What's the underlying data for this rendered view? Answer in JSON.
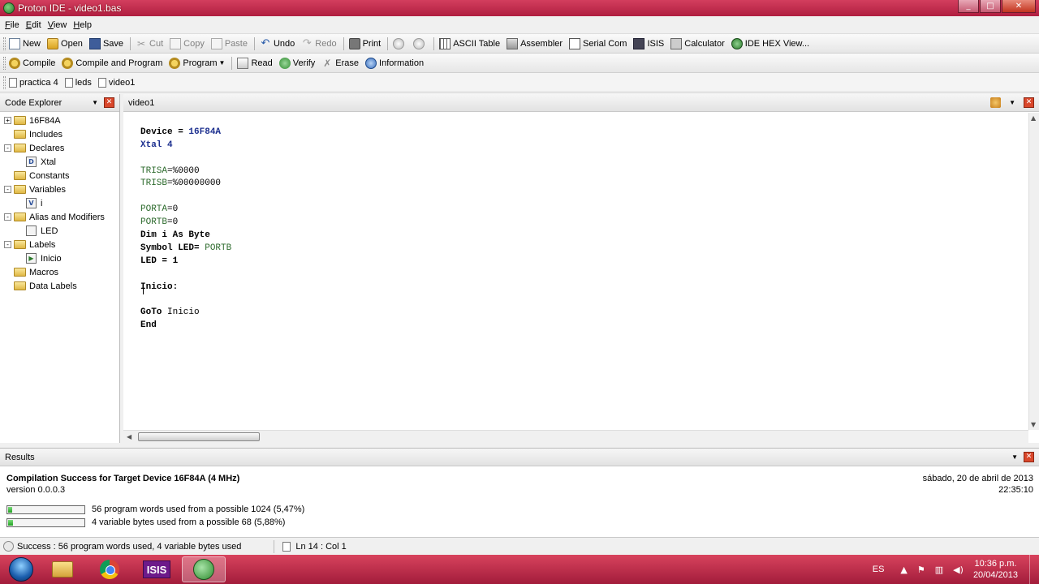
{
  "window": {
    "title": "Proton IDE - video1.bas",
    "min": "_",
    "max": "□",
    "close": "✕"
  },
  "menu": [
    "File",
    "Edit",
    "View",
    "Help"
  ],
  "toolbar1": {
    "new": "New",
    "open": "Open",
    "save": "Save",
    "cut": "Cut",
    "copy": "Copy",
    "paste": "Paste",
    "undo": "Undo",
    "redo": "Redo",
    "print": "Print",
    "ascii": "ASCII Table",
    "assembler": "Assembler",
    "serial": "Serial Com",
    "isis": "ISIS",
    "calculator": "Calculator",
    "hexview": "IDE HEX View..."
  },
  "toolbar2": {
    "compile": "Compile",
    "compile_program": "Compile and Program",
    "program": "Program",
    "read": "Read",
    "verify": "Verify",
    "erase": "Erase",
    "information": "Information"
  },
  "doc_tabs": [
    "practica 4",
    "leds",
    "video1"
  ],
  "explorer": {
    "title": "Code Explorer",
    "tree": [
      {
        "label": "16F84A",
        "expander": "+"
      },
      {
        "label": "Includes",
        "expander": ""
      },
      {
        "label": "Declares",
        "expander": "-"
      },
      {
        "label": "Xtal",
        "child": true,
        "icon": "D"
      },
      {
        "label": "Constants",
        "expander": ""
      },
      {
        "label": "Variables",
        "expander": "-"
      },
      {
        "label": "i",
        "child": true,
        "icon": "V"
      },
      {
        "label": "Alias and Modifiers",
        "expander": "-"
      },
      {
        "label": "LED",
        "child": true,
        "icon": ""
      },
      {
        "label": "Labels",
        "expander": "-"
      },
      {
        "label": "Inicio",
        "child": true,
        "icon": "▶"
      },
      {
        "label": "Macros",
        "expander": ""
      },
      {
        "label": "Data Labels",
        "expander": ""
      }
    ]
  },
  "editor": {
    "tab": "video1",
    "lines": {
      "l1a": "Device = ",
      "l1b": "16F84A",
      "l2a": "Xtal ",
      "l2b": "4",
      "l4a": "TRISA",
      "l4b": "=%0000",
      "l5a": "TRISB",
      "l5b": "=%00000000",
      "l7a": "PORTA",
      "l7b": "=0",
      "l8a": "PORTB",
      "l8b": "=0",
      "l9": "Dim i As Byte",
      "l10a": "Symbol LED= ",
      "l10b": "PORTB",
      "l11": "LED = 1",
      "l13": "Inicio:",
      "l15a": "GoTo",
      "l15b": " Inicio",
      "l16": "End"
    }
  },
  "results": {
    "title": "Results",
    "message": "Compilation Success for Target Device 16F84A (4 MHz)",
    "version": "version 0.0.0.3",
    "date": "sábado, 20 de abril de 2013",
    "time": "22:35:10",
    "words": {
      "text": "56 program words used from a possible 1024 (5,47%)",
      "fraction": 0.0547
    },
    "bytes": {
      "text": "4 variable bytes used from a possible 68 (5,88%)",
      "fraction": 0.0588
    }
  },
  "status": {
    "message": "Success : 56 program words used, 4 variable bytes used",
    "position": "Ln 14 : Col 1"
  },
  "taskbar": {
    "lang": "ES",
    "time": "10:36 p.m.",
    "date": "20/04/2013",
    "isis_label": "ISIS",
    "tray_up": "▲",
    "tray_flag": "⚑",
    "tray_net": "▥",
    "tray_vol": "◀)"
  }
}
